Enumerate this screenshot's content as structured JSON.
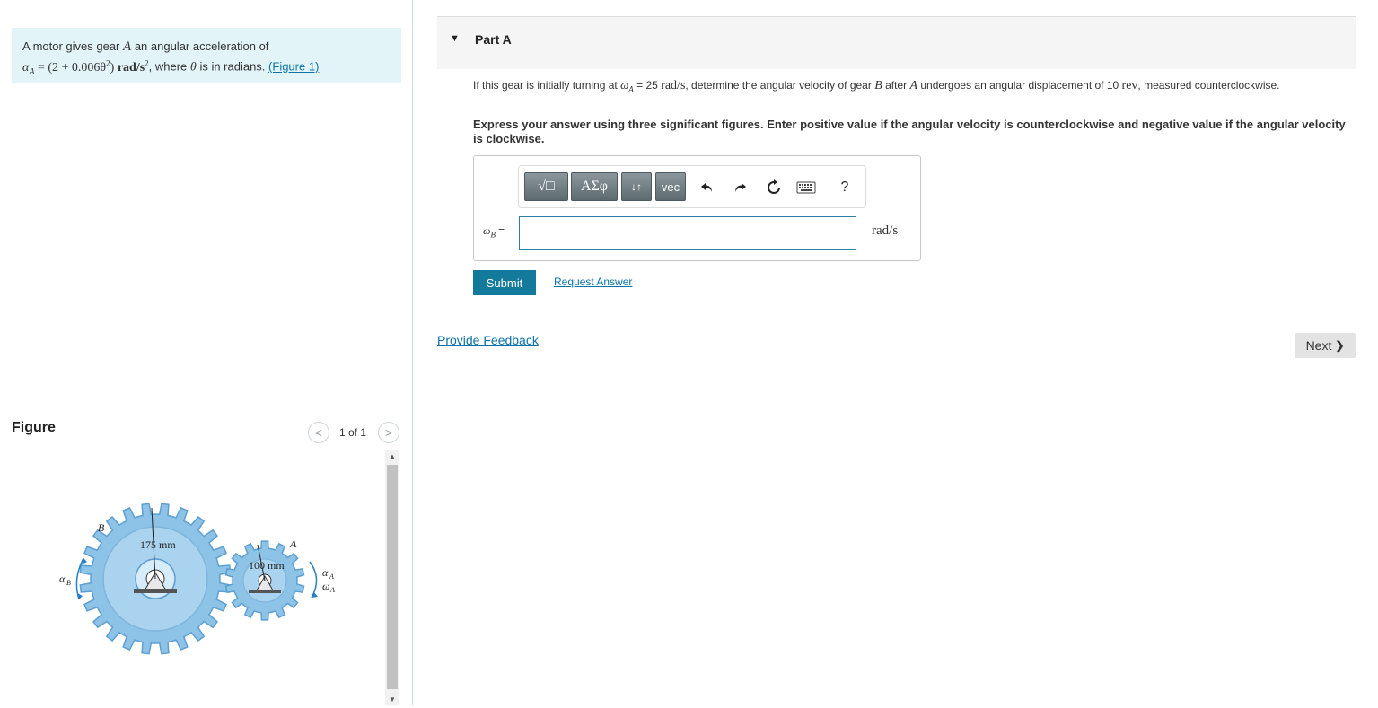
{
  "problem": {
    "text_1": "A motor gives gear",
    "gear_a": "A",
    "text_2": "an angular acceleration of",
    "formula_lhs": "α",
    "formula_lhs_sub": "A",
    "formula_rhs": "= (2 + 0.006θ",
    "formula_sup": "2",
    "formula_close": ")",
    "formula_unit": "rad/s",
    "formula_unit_sup": "2",
    "text_3": ", where",
    "theta": "θ",
    "text_4": "is in radians.",
    "figure_link": "(Figure 1)"
  },
  "figure": {
    "title": "Figure",
    "pager": "1 of 1",
    "prev_symbol": "<",
    "next_symbol": ">",
    "labels": {
      "gear_b": "B",
      "gear_a": "A",
      "radius_b": "175 mm",
      "radius_a": "100 mm",
      "alpha": "α",
      "alpha_b_sub": "B",
      "alpha_a_sub": "A",
      "omega": "ω",
      "omega_a_sub": "A"
    },
    "gear_color": "#8ec3e8",
    "gear_stroke": "#5d9fd0"
  },
  "part": {
    "title": "Part A"
  },
  "question": {
    "text_1": "If this gear is initially turning at",
    "omega": "ω",
    "omega_sub": "A",
    "eq": "= 25",
    "unit": "rad/s",
    "text_2": ", determine the angular velocity of gear",
    "gear_b": "B",
    "text_3": "after",
    "gear_a": "A",
    "text_4": "undergoes an angular displacement of 10",
    "rev": "rev",
    "text_5": ", measured counterclockwise."
  },
  "instructions": "Express your answer using three significant figures. Enter positive value if the angular velocity is counterclockwise and negative value if the angular velocity is clockwise.",
  "toolbar": {
    "templates_label": "√□",
    "greek_label": "ΑΣφ",
    "arrows_label": "↓↑",
    "vec_label": "vec",
    "undo_icon": "undo-icon",
    "redo_icon": "redo-icon",
    "reset_icon": "reset-icon",
    "keyboard_icon": "keyboard-icon",
    "help_label": "?"
  },
  "answer": {
    "label_omega": "ω",
    "label_sub": "B",
    "label_eq": "=",
    "value": "",
    "unit": "rad/s"
  },
  "buttons": {
    "submit": "Submit",
    "request_answer": "Request Answer",
    "provide_feedback": "Provide Feedback",
    "next": "Next",
    "next_chevron": "❯"
  },
  "colors": {
    "problem_bg": "#e3f4f8",
    "link": "#0b73a8",
    "submit_bg": "#137a9c",
    "input_border": "#2a7ea6"
  }
}
